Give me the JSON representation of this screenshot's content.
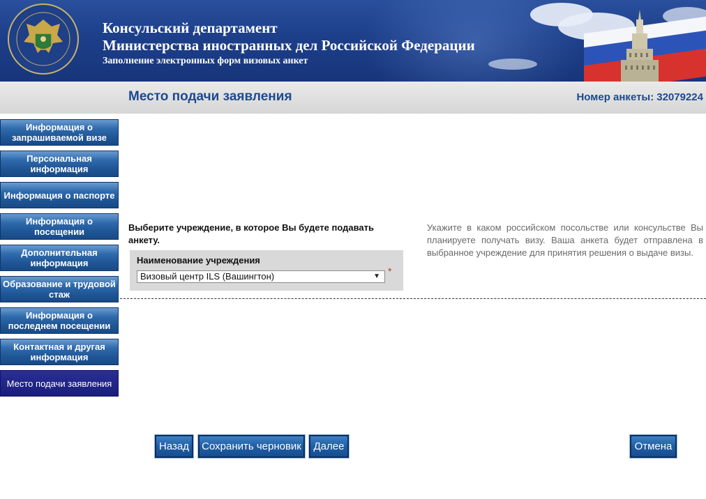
{
  "header": {
    "line1": "Консульский департамент",
    "line2": "Министерства иностранных дел Российской Федерации",
    "line3": "Заполнение электронных форм визовых анкет"
  },
  "titlebar": {
    "page_title": "Место подачи заявления",
    "anketa_label": "Номер анкеты:",
    "anketa_number": "32079224"
  },
  "nav": {
    "items": [
      {
        "label": "Информация о запрашиваемой визе"
      },
      {
        "label": "Персональная информация"
      },
      {
        "label": "Информация о паспорте"
      },
      {
        "label": "Информация о посещении"
      },
      {
        "label": "Дополнительная информация"
      },
      {
        "label": "Образование и трудовой стаж"
      },
      {
        "label": "Информация о последнем посещении"
      },
      {
        "label": "Контактная и другая информация"
      },
      {
        "label": "Место подачи заявления"
      }
    ]
  },
  "main": {
    "prompt": "Выберите учреждение, в которое Вы будете подавать анкету.",
    "field_label": "Наименование учреждения",
    "selected_value": "Визовый центр ILS (Вашингтон)",
    "required_mark": "*",
    "hint": "Укажите в каком российском посольстве или консульстве Вы планируете получать визу. Ваша анкета будет отправлена в выбранное учреждение для принятия решения о выдаче визы."
  },
  "buttons": {
    "back": "Назад",
    "save_draft": "Сохранить черновик",
    "next": "Далее",
    "cancel": "Отмена"
  },
  "icons": {
    "seal": "ministry-seal-icon",
    "dropdown": "dropdown-arrow-icon"
  }
}
